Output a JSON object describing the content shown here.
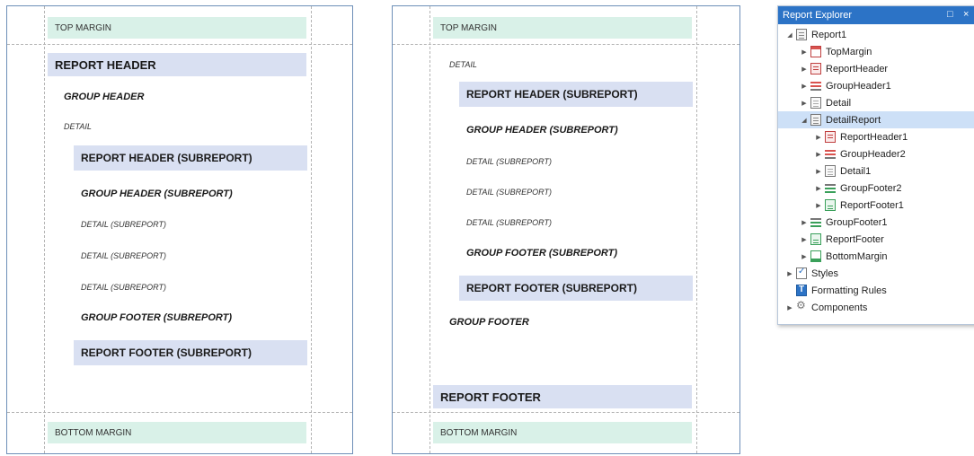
{
  "left_page": {
    "top_margin": "TOP MARGIN",
    "report_header": "REPORT HEADER",
    "group_header": "GROUP HEADER",
    "detail": "DETAIL",
    "sub_report_header": "REPORT HEADER (SUBREPORT)",
    "sub_group_header": "GROUP HEADER (SUBREPORT)",
    "sub_details": [
      "DETAIL (SUBREPORT)",
      "DETAIL (SUBREPORT)",
      "DETAIL (SUBREPORT)"
    ],
    "sub_group_footer": "GROUP FOOTER (SUBREPORT)",
    "sub_report_footer": "REPORT FOOTER (SUBREPORT)",
    "bottom_margin": "BOTTOM MARGIN"
  },
  "right_page": {
    "top_margin": "TOP MARGIN",
    "detail": "DETAIL",
    "sub_report_header": "REPORT HEADER (SUBREPORT)",
    "sub_group_header": "GROUP HEADER (SUBREPORT)",
    "sub_details": [
      "DETAIL (SUBREPORT)",
      "DETAIL (SUBREPORT)",
      "DETAIL (SUBREPORT)"
    ],
    "sub_group_footer": "GROUP FOOTER (SUBREPORT)",
    "sub_report_footer": "REPORT FOOTER (SUBREPORT)",
    "group_footer": "GROUP FOOTER",
    "report_footer": "REPORT FOOTER",
    "bottom_margin": "BOTTOM MARGIN"
  },
  "explorer": {
    "title": "Report Explorer",
    "maximize_icon": "□",
    "close_icon": "×",
    "items": [
      {
        "label": "Report1",
        "level": 0,
        "expanded": true,
        "icon": "report-icon"
      },
      {
        "label": "TopMargin",
        "level": 1,
        "expanded": false,
        "icon": "top-margin-icon"
      },
      {
        "label": "ReportHeader",
        "level": 1,
        "expanded": false,
        "icon": "report-header-icon"
      },
      {
        "label": "GroupHeader1",
        "level": 1,
        "expanded": false,
        "icon": "group-header-icon"
      },
      {
        "label": "Detail",
        "level": 1,
        "expanded": false,
        "icon": "detail-icon"
      },
      {
        "label": "DetailReport",
        "level": 1,
        "expanded": true,
        "selected": true,
        "icon": "detail-report-icon"
      },
      {
        "label": "ReportHeader1",
        "level": 2,
        "expanded": false,
        "icon": "report-header-icon"
      },
      {
        "label": "GroupHeader2",
        "level": 2,
        "expanded": false,
        "icon": "group-header-icon"
      },
      {
        "label": "Detail1",
        "level": 2,
        "expanded": false,
        "icon": "detail-icon"
      },
      {
        "label": "GroupFooter2",
        "level": 2,
        "expanded": false,
        "icon": "group-footer-icon"
      },
      {
        "label": "ReportFooter1",
        "level": 2,
        "expanded": false,
        "icon": "report-footer-icon"
      },
      {
        "label": "GroupFooter1",
        "level": 1,
        "expanded": false,
        "icon": "group-footer-icon"
      },
      {
        "label": "ReportFooter",
        "level": 1,
        "expanded": false,
        "icon": "report-footer-icon"
      },
      {
        "label": "BottomMargin",
        "level": 1,
        "expanded": false,
        "icon": "bottom-margin-icon"
      },
      {
        "label": "Styles",
        "level": 0,
        "expanded": false,
        "icon": "styles-icon"
      },
      {
        "label": "Formatting Rules",
        "level": 0,
        "leaf": true,
        "icon": "formatting-rules-icon"
      },
      {
        "label": "Components",
        "level": 0,
        "expanded": false,
        "icon": "components-icon"
      }
    ]
  },
  "colors": {
    "margin_band": "#d9f1e8",
    "header_band": "#d9e0f2",
    "page_border": "#6d8fb8",
    "explorer_title": "#2c73c6",
    "selection": "#cde0f7"
  }
}
